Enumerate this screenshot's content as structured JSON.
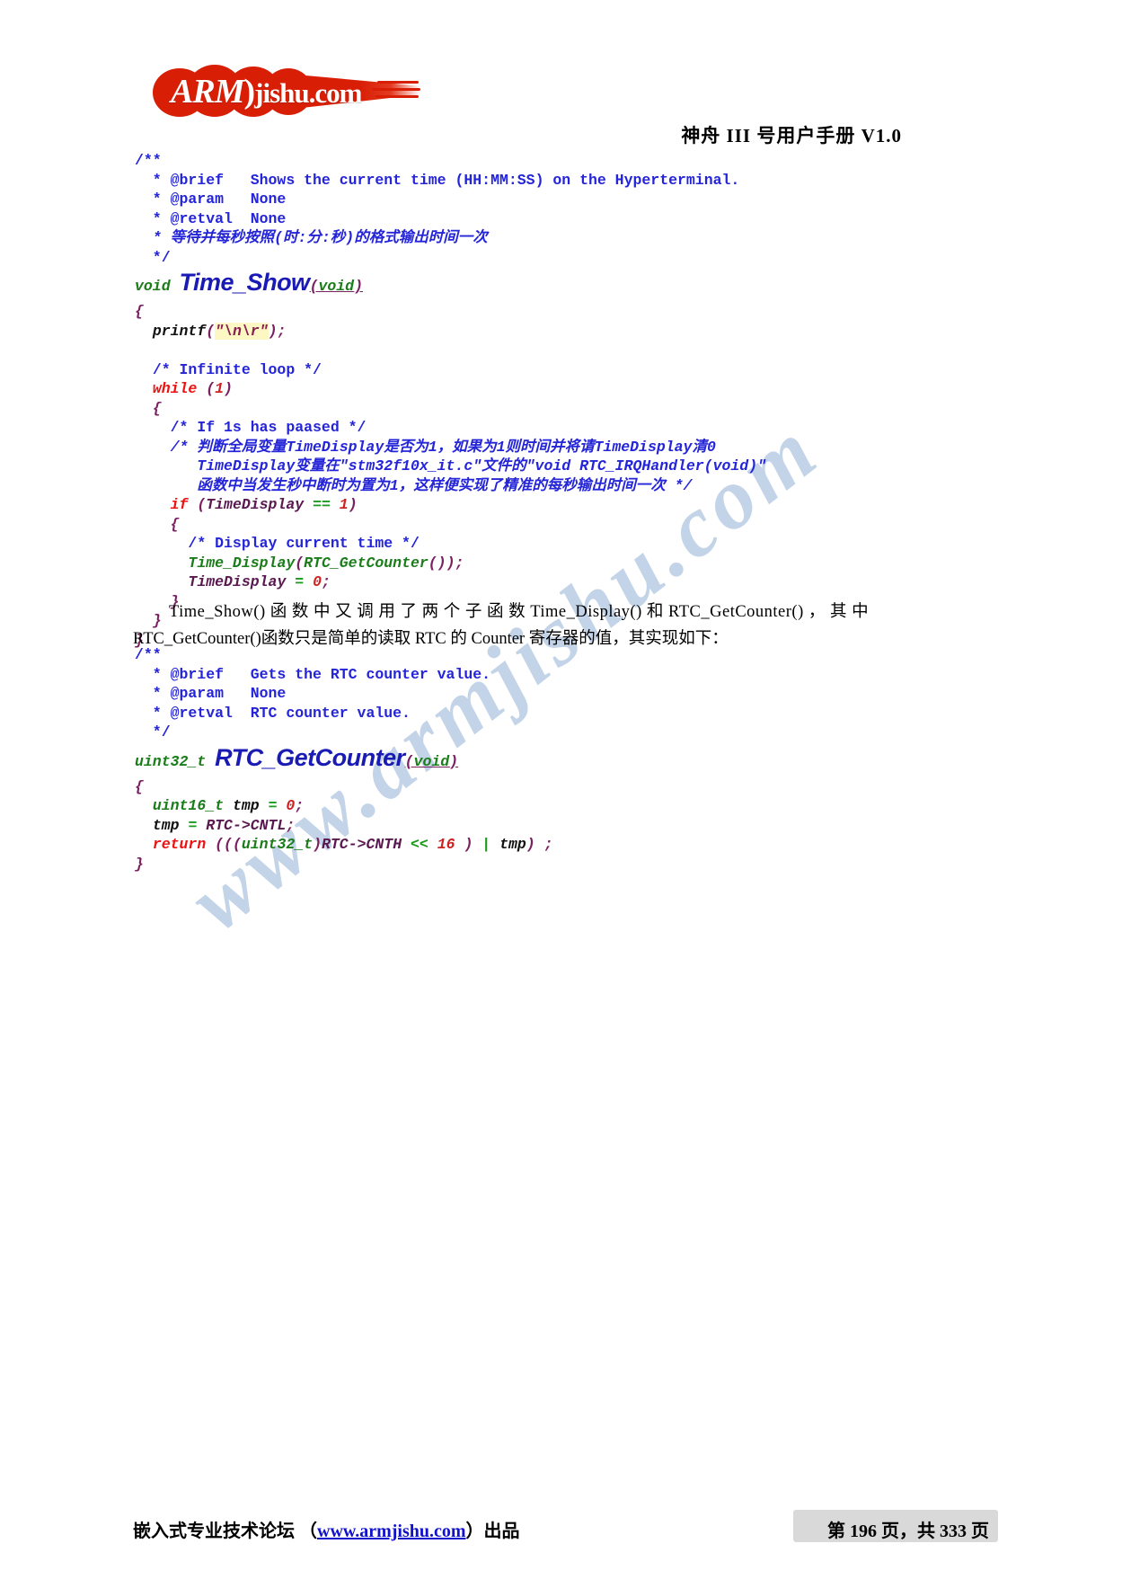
{
  "header": {
    "logo_text_arm": "ARM",
    "logo_text_paren": ")",
    "logo_text_domain": "jishu.com",
    "logo_alt": "ARM)jishu.com",
    "title": "神舟 III 号用户手册  V1.0"
  },
  "watermark": {
    "text": "www.armjishu.com"
  },
  "code_block_1": {
    "lines": [
      "/**",
      "  * @brief   Shows the current time (HH:MM:SS) on the Hyperterminal.",
      "  * @param   None",
      "  * @retval  None",
      "  * 等待并每秒按照(时:分:秒)的格式输出时间一次",
      "  */",
      "void Time_Show(void)",
      "{",
      "  printf(\"\\n\\r\");",
      "",
      "  /* Infinite loop */",
      "  while (1)",
      "  {",
      "    /* If 1s has paased */",
      "    /* 判断全局变量TimeDisplay是否为1，如果为1则时间并将请TimeDisplay清0",
      "       TimeDisplay变量在\"stm32f10x_it.c\"文件的\"void RTC_IRQHandler(void)\"",
      "       函数中当发生秒中断时为置为1，这样便实现了精准的每秒输出时间一次 */",
      "    if (TimeDisplay == 1)",
      "    {",
      "      /* Display current time */",
      "      Time_Display(RTC_GetCounter());",
      "      TimeDisplay = 0;",
      "    }",
      "  }",
      "}"
    ],
    "function_name": "Time_Show",
    "return_type": "void",
    "parameters": "(void)"
  },
  "paragraph": {
    "line1": "Time_Show() 函 数 中 又 调 用 了 两 个 子 函 数  Time_Display() 和  RTC_GetCounter() ， 其 中",
    "line2": "RTC_GetCounter()函数只是简单的读取 RTC 的 Counter 寄存器的值，其实现如下："
  },
  "code_block_2": {
    "lines": [
      "/**",
      "  * @brief   Gets the RTC counter value.",
      "  * @param   None",
      "  * @retval  RTC counter value.",
      "  */",
      "uint32_t RTC_GetCounter(void)",
      "{",
      "  uint16_t tmp = 0;",
      "  tmp = RTC->CNTL;",
      "  return (((uint32_t)RTC->CNTH << 16 ) | tmp) ;",
      "}"
    ],
    "function_name": "RTC_GetCounter",
    "return_type": "uint32_t",
    "parameters": "(void)"
  },
  "footer": {
    "left_prefix": "嵌入式专业技术论坛 （",
    "left_url": "www.armjishu.com",
    "left_suffix": "）出品",
    "page_prefix": "第",
    "page_current": "196",
    "page_mid": "页，共",
    "page_total": "333",
    "page_suffix": "页"
  },
  "colors": {
    "logo_red": "#d81e05",
    "comment_blue": "#2424d8",
    "type_green": "#1a7d1a",
    "keyword_red": "#ee1111",
    "punct_purple": "#7a2060",
    "string_bg": "#fdf7c3",
    "fname_blue": "#1a1ab4",
    "watermark_blue": "#b9cde4",
    "link_blue": "#1111cc"
  }
}
